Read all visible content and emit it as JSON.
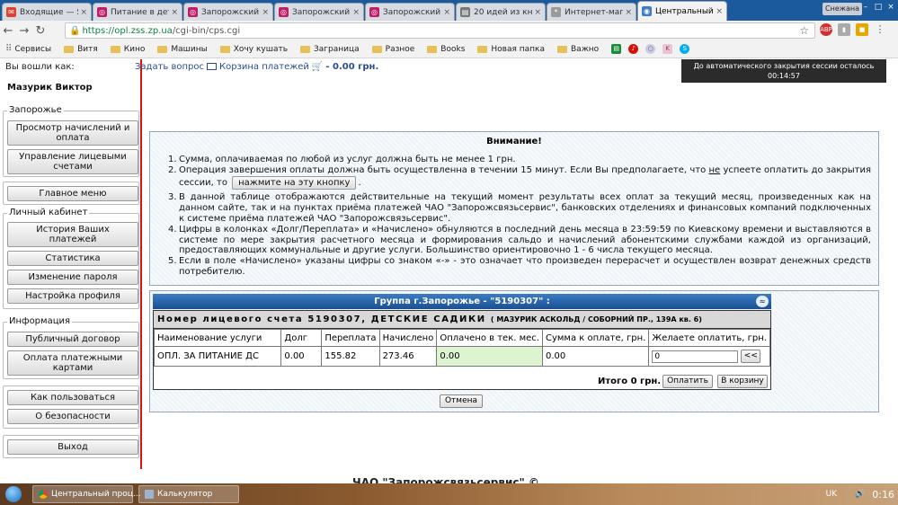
{
  "browser": {
    "tabs": [
      {
        "label": "Входящие — Ян",
        "icon_color": "#e2402f",
        "active": false
      },
      {
        "label": "Питание в детс",
        "icon_color": "#c21b6a",
        "active": false
      },
      {
        "label": "Запорожский",
        "icon_color": "#c21b6a",
        "active": false
      },
      {
        "label": "Запорожский",
        "icon_color": "#c21b6a",
        "active": false
      },
      {
        "label": "Запорожский",
        "icon_color": "#c21b6a",
        "active": false
      },
      {
        "label": "20 идей из кни",
        "icon_color": "#777777",
        "active": false
      },
      {
        "label": "Интернет-магаз",
        "icon_color": "#999999",
        "active": false
      },
      {
        "label": "Центральный п",
        "icon_color": "#3b7bc8",
        "active": true
      }
    ],
    "user_badge": "Снежана",
    "url_main": "https://opl.zss.zp.ua",
    "url_rest": "/cgi-bin/cps.cgi",
    "bookmarks": [
      {
        "label": "Сервисы",
        "kind": "apps"
      },
      {
        "label": "Витя",
        "kind": "folder"
      },
      {
        "label": "Кино",
        "kind": "folder"
      },
      {
        "label": "Машины",
        "kind": "folder"
      },
      {
        "label": "Хочу кушать",
        "kind": "folder"
      },
      {
        "label": "Заграница",
        "kind": "folder"
      },
      {
        "label": "Разное",
        "kind": "folder"
      },
      {
        "label": "Books",
        "kind": "folder"
      },
      {
        "label": "Новая папка",
        "kind": "folder"
      },
      {
        "label": "Важно",
        "kind": "folder"
      }
    ],
    "extension_icons": [
      "abp-icon",
      "bookmark-icon",
      "extension-icon",
      "menu-icon"
    ]
  },
  "sidebar": {
    "logged_in_label": "Вы вошли как:",
    "user_name": "Мазурик Виктор",
    "groups": [
      {
        "legend": "Запорожье",
        "items": [
          "Просмотр начислений и оплата",
          "Управление лицевыми счетами"
        ]
      },
      {
        "legend": "",
        "items": [
          "Главное меню"
        ]
      },
      {
        "legend": "Личный кабинет",
        "items": [
          "История Ваших платежей",
          "Статистика",
          "Изменение пароля",
          "Настройка профиля"
        ]
      },
      {
        "legend": "Информация",
        "items": [
          "Публичный договор",
          "Оплата платежными картами"
        ]
      },
      {
        "legend": "",
        "items": [
          "Как пользоваться",
          "О безопасности"
        ]
      },
      {
        "legend": "",
        "items": [
          "Выход"
        ]
      }
    ]
  },
  "topinfo": {
    "ask": "Задать вопрос",
    "cart": "Корзина платежей",
    "sum": "- 0.00 грн."
  },
  "session": {
    "label": "До автоматического закрытия сессии осталось",
    "time": "00:14:57"
  },
  "attention": {
    "title": "Внимание!",
    "item1": "Сумма, оплачиваемая по любой из услуг должна быть не менее 1 грн.",
    "item2_a": "Операция завершения оплаты должна быть осуществленна в течении 15 минут. Если Вы предполагаете, что",
    "item2_ne": "не",
    "item2_b": "успеете оплатить до закрытия сессии, то",
    "item2_btn": "нажмите на эту кнопку",
    "item3": "В данной таблице отображаются действительные на текущий момент результаты всех оплат за текущий месяц, произведенных как на данном сайте, так и на пунктах приёма платежей ЧАО \"Запорожсвязьсервис\", банковских отделениях и финансовых компаний подключенных к системе приёма платежей ЧАО \"Запорожсвязьсервис\".",
    "item4": "Цифры в колонках «Долг/Переплата» и «Начислено» обнуляются в последний день месяца в 23:59:59 по Киевскому времени и выставляются в системе по мере закрытия расчетного месяца и формирования сальдо и начислений абонентскими службами каждой из организаций, предоставляющих коммунальные и другие услуги. Большинство ориентировочно 1 - 6 числа текущего месяца.",
    "item5": "Если в поле «Начислено» указаны цифры со знаком «-» - это означает что произведен перерасчет и осуществлен возврат денежных средств потребителю."
  },
  "payment": {
    "group_title": "Группа г.Запорожье - \"5190307\" :",
    "account_label": "Номер лицевого счета 5190307, ДЕТСКИЕ САДИКИ",
    "account_address": "( МАЗУРИК АСКОЛЬД / СОБОРНИЙ ПР., 139А кв. 6)",
    "columns": [
      "Наименование услуги",
      "Долг",
      "Переплата",
      "Начислено",
      "Оплачено в тек. мес.",
      "Сумма к оплате, грн.",
      "Желаете оплатить, грн."
    ],
    "row": {
      "service": "ОПЛ. ЗА ПИТАНИЕ ДС",
      "debt": "0.00",
      "overpay": "155.82",
      "charged": "273.46",
      "paid": "0.00",
      "to_pay": "0.00",
      "wish": "0"
    },
    "row_button": "<<",
    "total": "Итого 0 грн.",
    "pay_button": "Оплатить",
    "cart_button": "В корзину",
    "cancel_button": "Отмена"
  },
  "footer": "ЧАО \"Запорожсвязьсервис\" ©",
  "taskbar": {
    "tasks": [
      "Центральный проц...",
      "Калькулятор"
    ],
    "lang": "UK",
    "clock": "0:16"
  }
}
